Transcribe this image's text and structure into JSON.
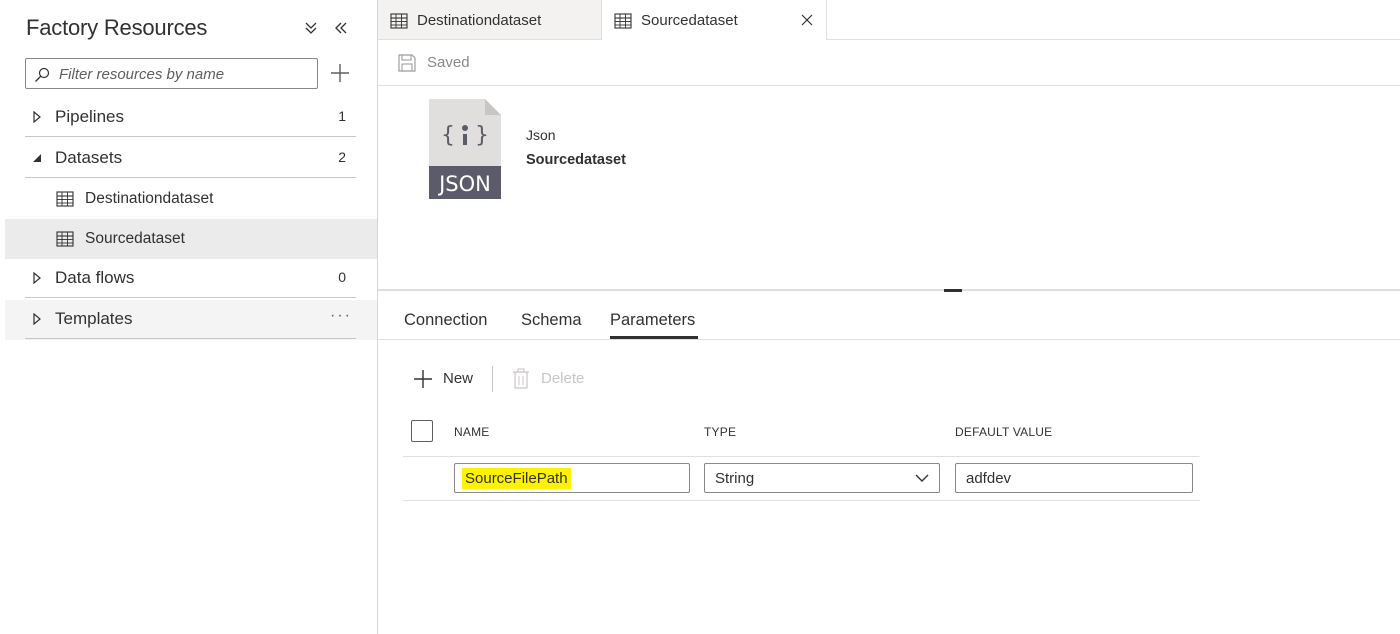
{
  "left_pane": {
    "title": "Factory Resources",
    "filter_placeholder": "Filter resources by name",
    "tree": {
      "pipelines": {
        "label": "Pipelines",
        "count": "1"
      },
      "datasets": {
        "label": "Datasets",
        "count": "2",
        "children": [
          {
            "label": "Destinationdataset",
            "selected": false
          },
          {
            "label": "Sourcedataset",
            "selected": true
          }
        ]
      },
      "dataflows": {
        "label": "Data flows",
        "count": "0"
      },
      "templates": {
        "label": "Templates",
        "more": "···"
      }
    }
  },
  "tabs": [
    {
      "label": "Destinationdataset",
      "active": false
    },
    {
      "label": "Sourcedataset",
      "active": true
    }
  ],
  "toolbar": {
    "saved_label": "Saved"
  },
  "dataset": {
    "type": "Json",
    "name": "Sourcedataset",
    "icon_text": "JSON"
  },
  "property_tabs": [
    {
      "label": "Connection",
      "active": false
    },
    {
      "label": "Schema",
      "active": false
    },
    {
      "label": "Parameters",
      "active": true
    }
  ],
  "parameters_toolbar": {
    "new_label": "New",
    "delete_label": "Delete"
  },
  "parameters_table": {
    "columns": [
      "NAME",
      "TYPE",
      "DEFAULT VALUE"
    ],
    "rows": [
      {
        "name": "SourceFilePath",
        "type": "String",
        "default_value": "adfdev"
      }
    ]
  },
  "colors": {
    "highlight": "#fff200",
    "selected_row": "#ebebeb",
    "text": "#323130"
  }
}
